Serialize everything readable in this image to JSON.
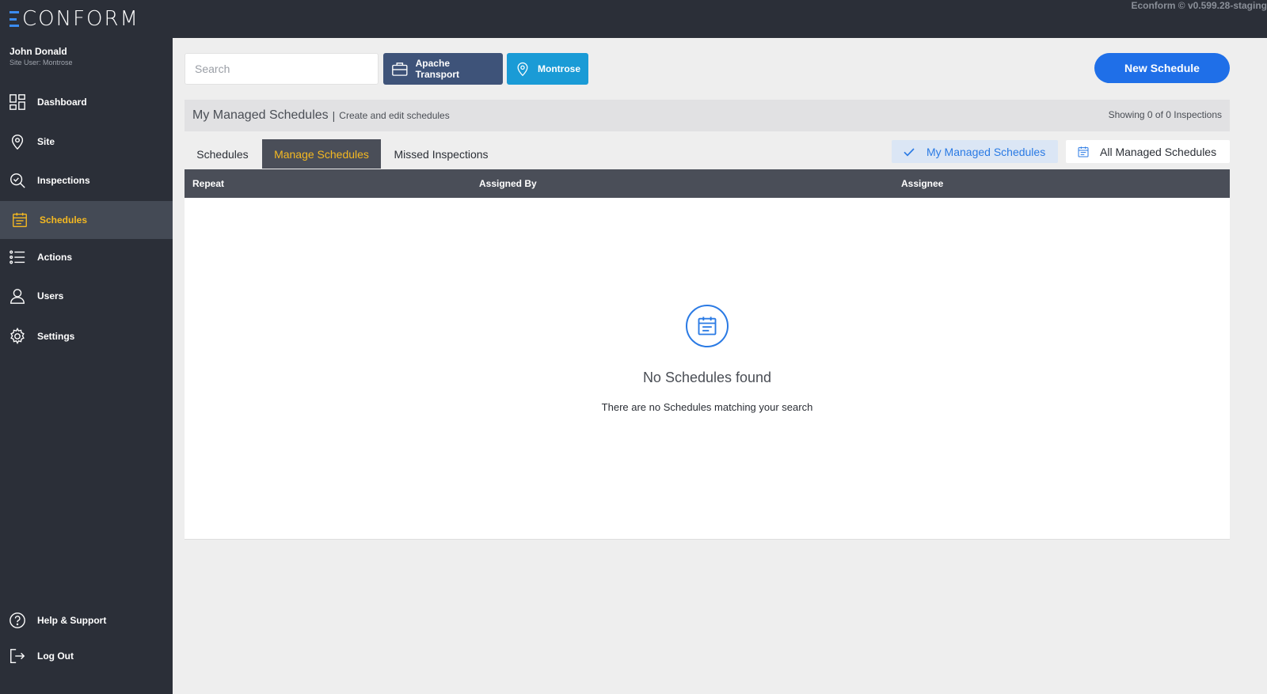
{
  "app": {
    "logo_text": "CONFORM",
    "version": "Econform © v0.599.28-staging"
  },
  "user": {
    "name": "John Donald",
    "role": "Site User: Montrose"
  },
  "sidebar": {
    "items": [
      {
        "label": "Dashboard",
        "icon": "dashboard-icon"
      },
      {
        "label": "Site",
        "icon": "location-pin-icon"
      },
      {
        "label": "Inspections",
        "icon": "search-check-icon"
      },
      {
        "label": "Schedules",
        "icon": "calendar-icon",
        "active": true
      },
      {
        "label": "Actions",
        "icon": "list-icon"
      },
      {
        "label": "Users",
        "icon": "user-icon"
      },
      {
        "label": "Settings",
        "icon": "gear-icon"
      }
    ],
    "footer": [
      {
        "label": "Help & Support",
        "icon": "help-icon"
      },
      {
        "label": "Log Out",
        "icon": "logout-icon"
      }
    ]
  },
  "toolbar": {
    "search_placeholder": "Search",
    "company_label": "Apache Transport",
    "site_label": "Montrose",
    "new_schedule_label": "New Schedule"
  },
  "page": {
    "title": "My Managed Schedules",
    "separator": "|",
    "subtitle": "Create and edit schedules",
    "showing": "Showing 0 of 0 Inspections"
  },
  "tabs": [
    {
      "label": "Schedules"
    },
    {
      "label": "Manage Schedules",
      "active": true
    },
    {
      "label": "Missed Inspections"
    }
  ],
  "filters": {
    "my_label": "My Managed Schedules",
    "all_label": "All Managed Schedules"
  },
  "table": {
    "columns": [
      "Repeat",
      "Assigned By",
      "Assignee"
    ]
  },
  "empty_state": {
    "title": "No Schedules found",
    "description": "There are no Schedules matching your search"
  },
  "colors": {
    "accent_yellow": "#f5b921",
    "primary_blue": "#1f6fe8",
    "sidebar_bg": "#2b2f38"
  }
}
